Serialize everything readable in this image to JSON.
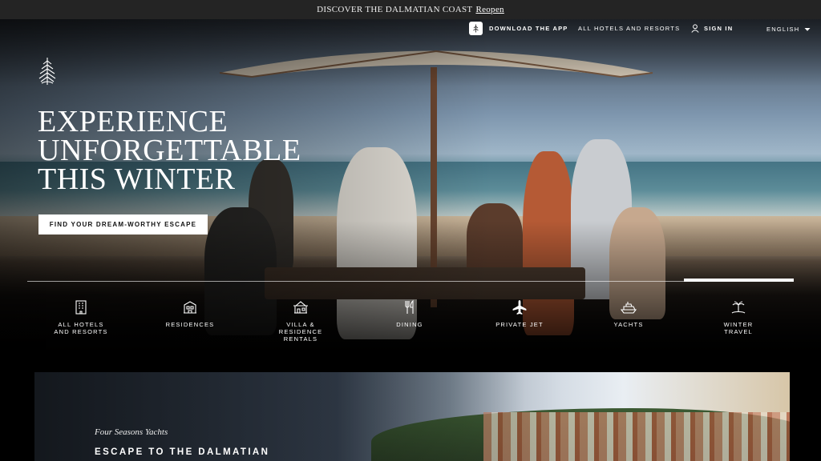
{
  "announcement": {
    "text": "DISCOVER THE DALMATIAN COAST",
    "link": "Reopen"
  },
  "nav": {
    "app": "DOWNLOAD THE APP",
    "all_hotels": "ALL HOTELS AND RESORTS",
    "sign_in": "SIGN IN",
    "language": "ENGLISH"
  },
  "hero": {
    "headline": [
      "EXPERIENCE",
      "UNFORGETTABLE",
      "THIS WINTER"
    ],
    "cta": "FIND YOUR DREAM-WORTHY ESCAPE"
  },
  "categories": [
    {
      "label": "ALL HOTELS\nAND RESORTS",
      "icon": "building-icon"
    },
    {
      "label": "RESIDENCES",
      "icon": "residence-icon"
    },
    {
      "label": "VILLA &\nRESIDENCE\nRENTALS",
      "icon": "villa-icon"
    },
    {
      "label": "DINING",
      "icon": "fork-knife-icon"
    },
    {
      "label": "PRIVATE JET",
      "icon": "plane-icon"
    },
    {
      "label": "YACHTS",
      "icon": "yacht-icon"
    },
    {
      "label": "WINTER\nTRAVEL",
      "icon": "island-icon"
    }
  ],
  "promo": {
    "kicker": "Four Seasons Yachts",
    "title": "ESCAPE TO THE DALMATIAN"
  }
}
